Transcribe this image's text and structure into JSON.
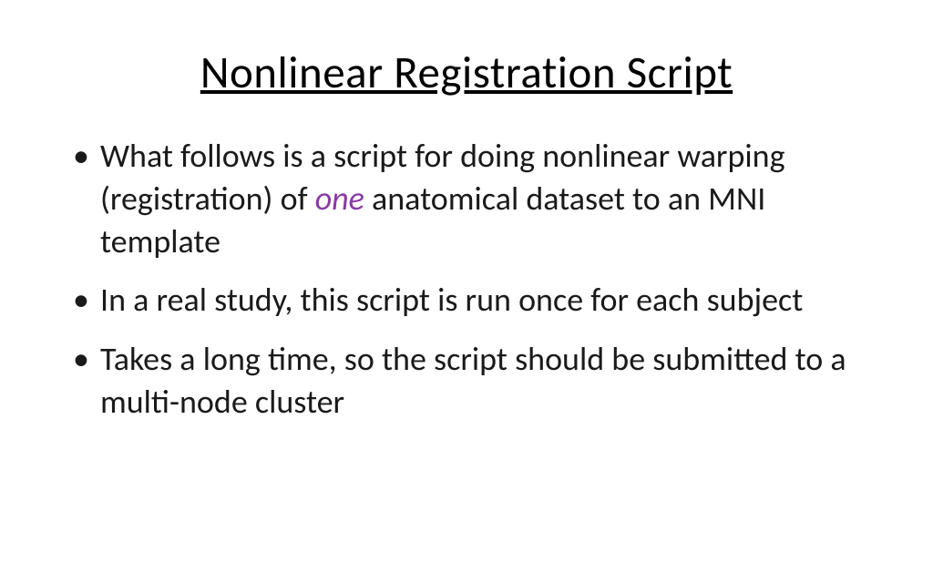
{
  "slide": {
    "title": "Nonlinear Registration Script",
    "bullets": [
      {
        "text_before": "What follows is a script for doing nonlinear warping (registration) of ",
        "highlight": "one",
        "text_after": " anatomical dataset to an MNI template"
      },
      {
        "text_before": "In a real study, this script is run once for each subject",
        "highlight": "",
        "text_after": ""
      },
      {
        "text_before": "Takes a long time, so the script should be submitted to a multi-node cluster",
        "highlight": "",
        "text_after": ""
      }
    ]
  }
}
